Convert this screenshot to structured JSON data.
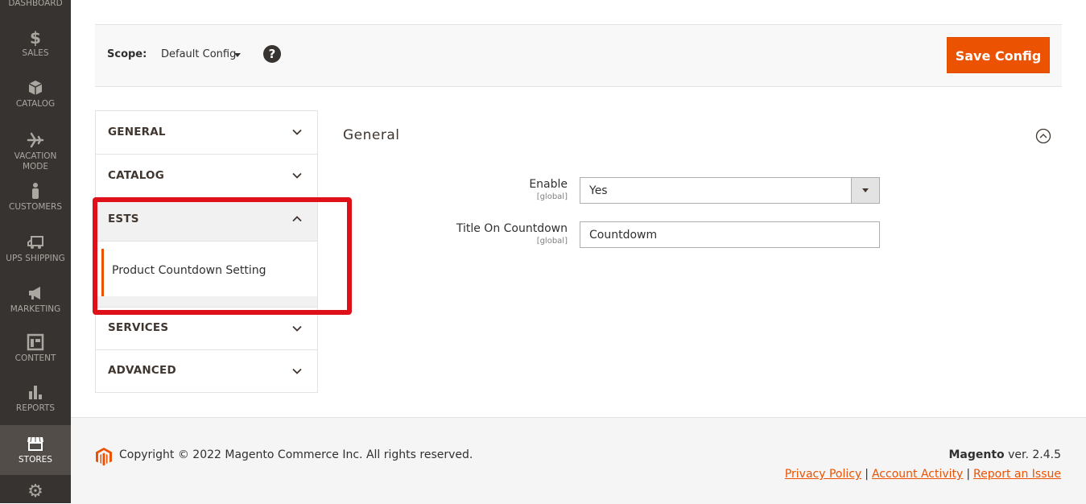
{
  "sidebar": {
    "items": [
      {
        "label": "DASHBOARD",
        "icon": "dashboard-icon"
      },
      {
        "label": "SALES",
        "icon": "dollar-icon"
      },
      {
        "label": "CATALOG",
        "icon": "cube-icon"
      },
      {
        "label": "VACATION MODE",
        "icon": "airplane-icon"
      },
      {
        "label": "CUSTOMERS",
        "icon": "person-icon"
      },
      {
        "label": "UPS SHIPPING",
        "icon": "truck-icon"
      },
      {
        "label": "MARKETING",
        "icon": "megaphone-icon"
      },
      {
        "label": "CONTENT",
        "icon": "layout-icon"
      },
      {
        "label": "REPORTS",
        "icon": "bar-chart-icon"
      },
      {
        "label": "STORES",
        "icon": "store-icon",
        "active": true
      },
      {
        "label": "",
        "icon": "gear-icon"
      }
    ]
  },
  "scope": {
    "label": "Scope:",
    "value": "Default Config",
    "help": "?"
  },
  "actions": {
    "save_label": "Save Config"
  },
  "tabs": {
    "general": "GENERAL",
    "catalog": "CATALOG",
    "ests": "ESTS",
    "ests_item": "Product Countdown Setting",
    "services": "SERVICES",
    "advanced": "ADVANCED"
  },
  "section": {
    "title": "General",
    "fields": {
      "enable": {
        "label": "Enable",
        "scope": "[global]",
        "value": "Yes"
      },
      "title": {
        "label": "Title On Countdown",
        "scope": "[global]",
        "value": "Countdowm"
      }
    }
  },
  "footer": {
    "copyright": "Copyright © 2022 Magento Commerce Inc. All rights reserved.",
    "brand": "Magento",
    "version": "ver. 2.4.5",
    "links": [
      "Privacy Policy",
      "Account Activity",
      "Report an Issue"
    ],
    "separator": "|"
  },
  "colors": {
    "accent": "#eb5202",
    "sidebar_bg": "#373330",
    "highlight": "#e0101a"
  }
}
